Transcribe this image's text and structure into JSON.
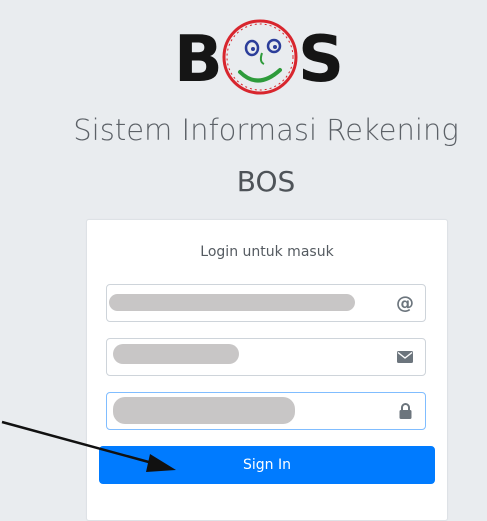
{
  "logo": {
    "letter_left": "B",
    "letter_right": "S",
    "colors": {
      "letters": "#151515",
      "ring": "#d8262e",
      "eyes": "#2c3e9a",
      "smile": "#2e9b3b"
    }
  },
  "header": {
    "title": "Sistem Informasi Rekening",
    "subtitle": "BOS"
  },
  "login": {
    "message": "Login untuk masuk",
    "fields": {
      "email": {
        "value": "",
        "icon": "at-icon"
      },
      "mail": {
        "value": "",
        "icon": "envelope-icon"
      },
      "password": {
        "value": "",
        "icon": "lock-icon"
      }
    },
    "submit_label": "Sign In"
  },
  "colors": {
    "background": "#e9ecef",
    "primary": "#007bff",
    "redaction": "#c8c6c6"
  }
}
